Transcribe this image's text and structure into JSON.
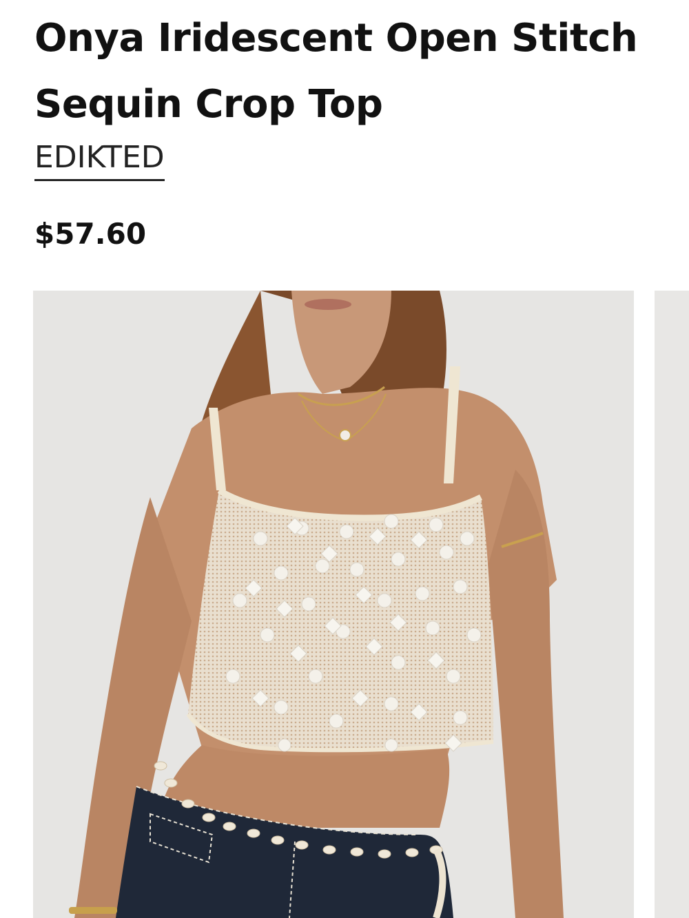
{
  "product": {
    "title": "Onya Iridescent Open Stitch Sequin Crop Top",
    "brand": "EDIKTED",
    "price": "$57.60"
  },
  "gallery": {
    "main_image": "product-photo",
    "next_image": "product-photo"
  }
}
